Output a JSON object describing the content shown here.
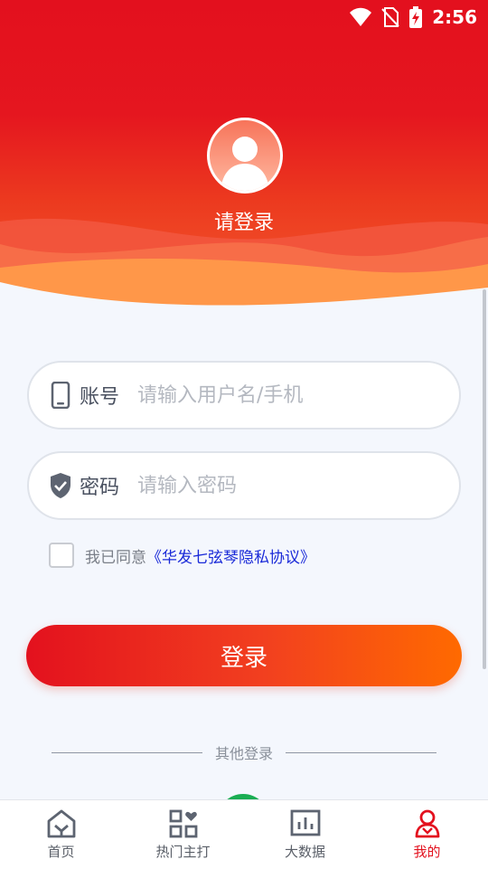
{
  "status_bar": {
    "time": "2:56"
  },
  "header": {
    "login_hint": "请登录"
  },
  "account_field": {
    "label": "账号",
    "placeholder": "请输入用户名/手机",
    "value": ""
  },
  "password_field": {
    "label": "密码",
    "placeholder": "请输入密码",
    "value": ""
  },
  "agreement": {
    "prefix": "我已同意",
    "link": "《华发七弦琴隐私协议》",
    "checked": false
  },
  "login_button": {
    "label": "登录"
  },
  "other_login": {
    "label": "其他登录"
  },
  "tabbar": {
    "items": [
      {
        "label": "首页",
        "icon": "home-icon",
        "active": false
      },
      {
        "label": "热门主打",
        "icon": "grid-heart-icon",
        "active": false
      },
      {
        "label": "大数据",
        "icon": "bar-chart-icon",
        "active": false
      },
      {
        "label": "我的",
        "icon": "user-icon",
        "active": true
      }
    ]
  },
  "colors": {
    "brand_red": "#e3111e",
    "brand_orange": "#ff6a00",
    "link_blue": "#1a2ad8"
  }
}
